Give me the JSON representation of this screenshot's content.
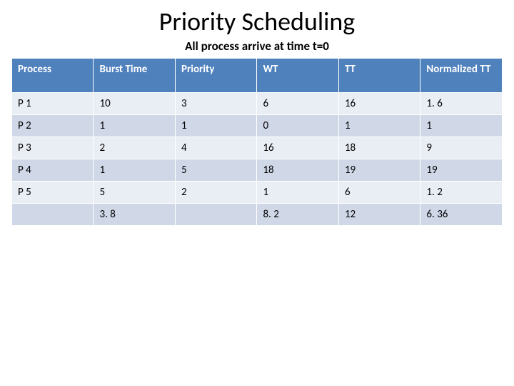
{
  "title": "Priority Scheduling",
  "subtitle": "All process arrive at time t=0",
  "headers": [
    "Process",
    "Burst Time",
    "Priority",
    "WT",
    "TT",
    "Normalized TT"
  ],
  "rows": [
    [
      "P 1",
      "10",
      "3",
      "6",
      "16",
      "1. 6"
    ],
    [
      "P 2",
      "1",
      "1",
      "0",
      "1",
      "1"
    ],
    [
      "P 3",
      "2",
      "4",
      "16",
      "18",
      "9"
    ],
    [
      "P 4",
      "1",
      "5",
      "18",
      "19",
      "19"
    ],
    [
      "P 5",
      "5",
      "2",
      "1",
      "6",
      "1. 2"
    ],
    [
      "",
      "3. 8",
      "",
      "8. 2",
      "12",
      "6. 36"
    ]
  ],
  "chart_data": {
    "type": "table",
    "title": "Priority Scheduling",
    "columns": [
      "Process",
      "Burst Time",
      "Priority",
      "WT",
      "TT",
      "Normalized TT"
    ],
    "data": [
      {
        "Process": "P1",
        "Burst Time": 10,
        "Priority": 3,
        "WT": 6,
        "TT": 16,
        "Normalized TT": 1.6
      },
      {
        "Process": "P2",
        "Burst Time": 1,
        "Priority": 1,
        "WT": 0,
        "TT": 1,
        "Normalized TT": 1
      },
      {
        "Process": "P3",
        "Burst Time": 2,
        "Priority": 4,
        "WT": 16,
        "TT": 18,
        "Normalized TT": 9
      },
      {
        "Process": "P4",
        "Burst Time": 1,
        "Priority": 5,
        "WT": 18,
        "TT": 19,
        "Normalized TT": 19
      },
      {
        "Process": "P5",
        "Burst Time": 5,
        "Priority": 2,
        "WT": 1,
        "TT": 6,
        "Normalized TT": 1.2
      }
    ],
    "averages": {
      "Burst Time": 3.8,
      "WT": 8.2,
      "TT": 12,
      "Normalized TT": 6.36
    }
  }
}
